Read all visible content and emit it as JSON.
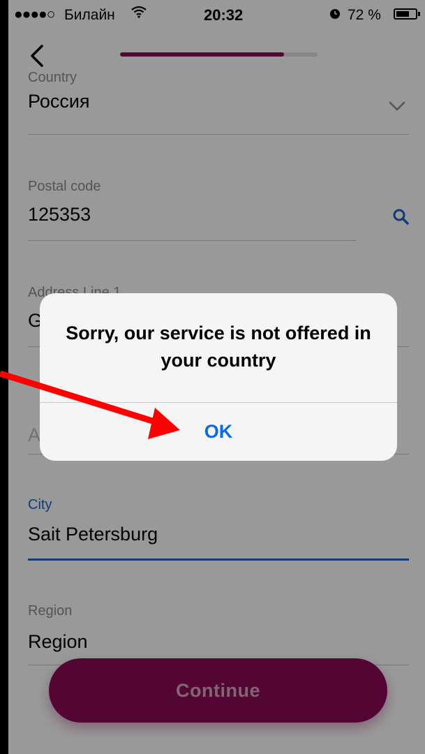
{
  "status_bar": {
    "signal": "●●●●○",
    "carrier": "Билайн",
    "time": "20:32",
    "battery": "72 %",
    "battery_level": 0.72
  },
  "nav": {
    "progress": 0.83
  },
  "form": {
    "country": {
      "label": "Country",
      "value": "Россия"
    },
    "postal_code": {
      "label": "Postal code",
      "value": "125353"
    },
    "address_line_1": {
      "label": "Address Line 1",
      "value": "G"
    },
    "address_line_2": {
      "placeholder": "A"
    },
    "city": {
      "label": "City",
      "value": "Sait Petersburg"
    },
    "region": {
      "label": "Region",
      "value": "Region"
    }
  },
  "continue_label": "Continue",
  "alert": {
    "message": "Sorry, our service is not offered in your country",
    "ok_label": "OK"
  },
  "colors": {
    "brand": "#8b0a55",
    "active_blue": "#1b63c4",
    "annotation_red": "#ff0000"
  }
}
